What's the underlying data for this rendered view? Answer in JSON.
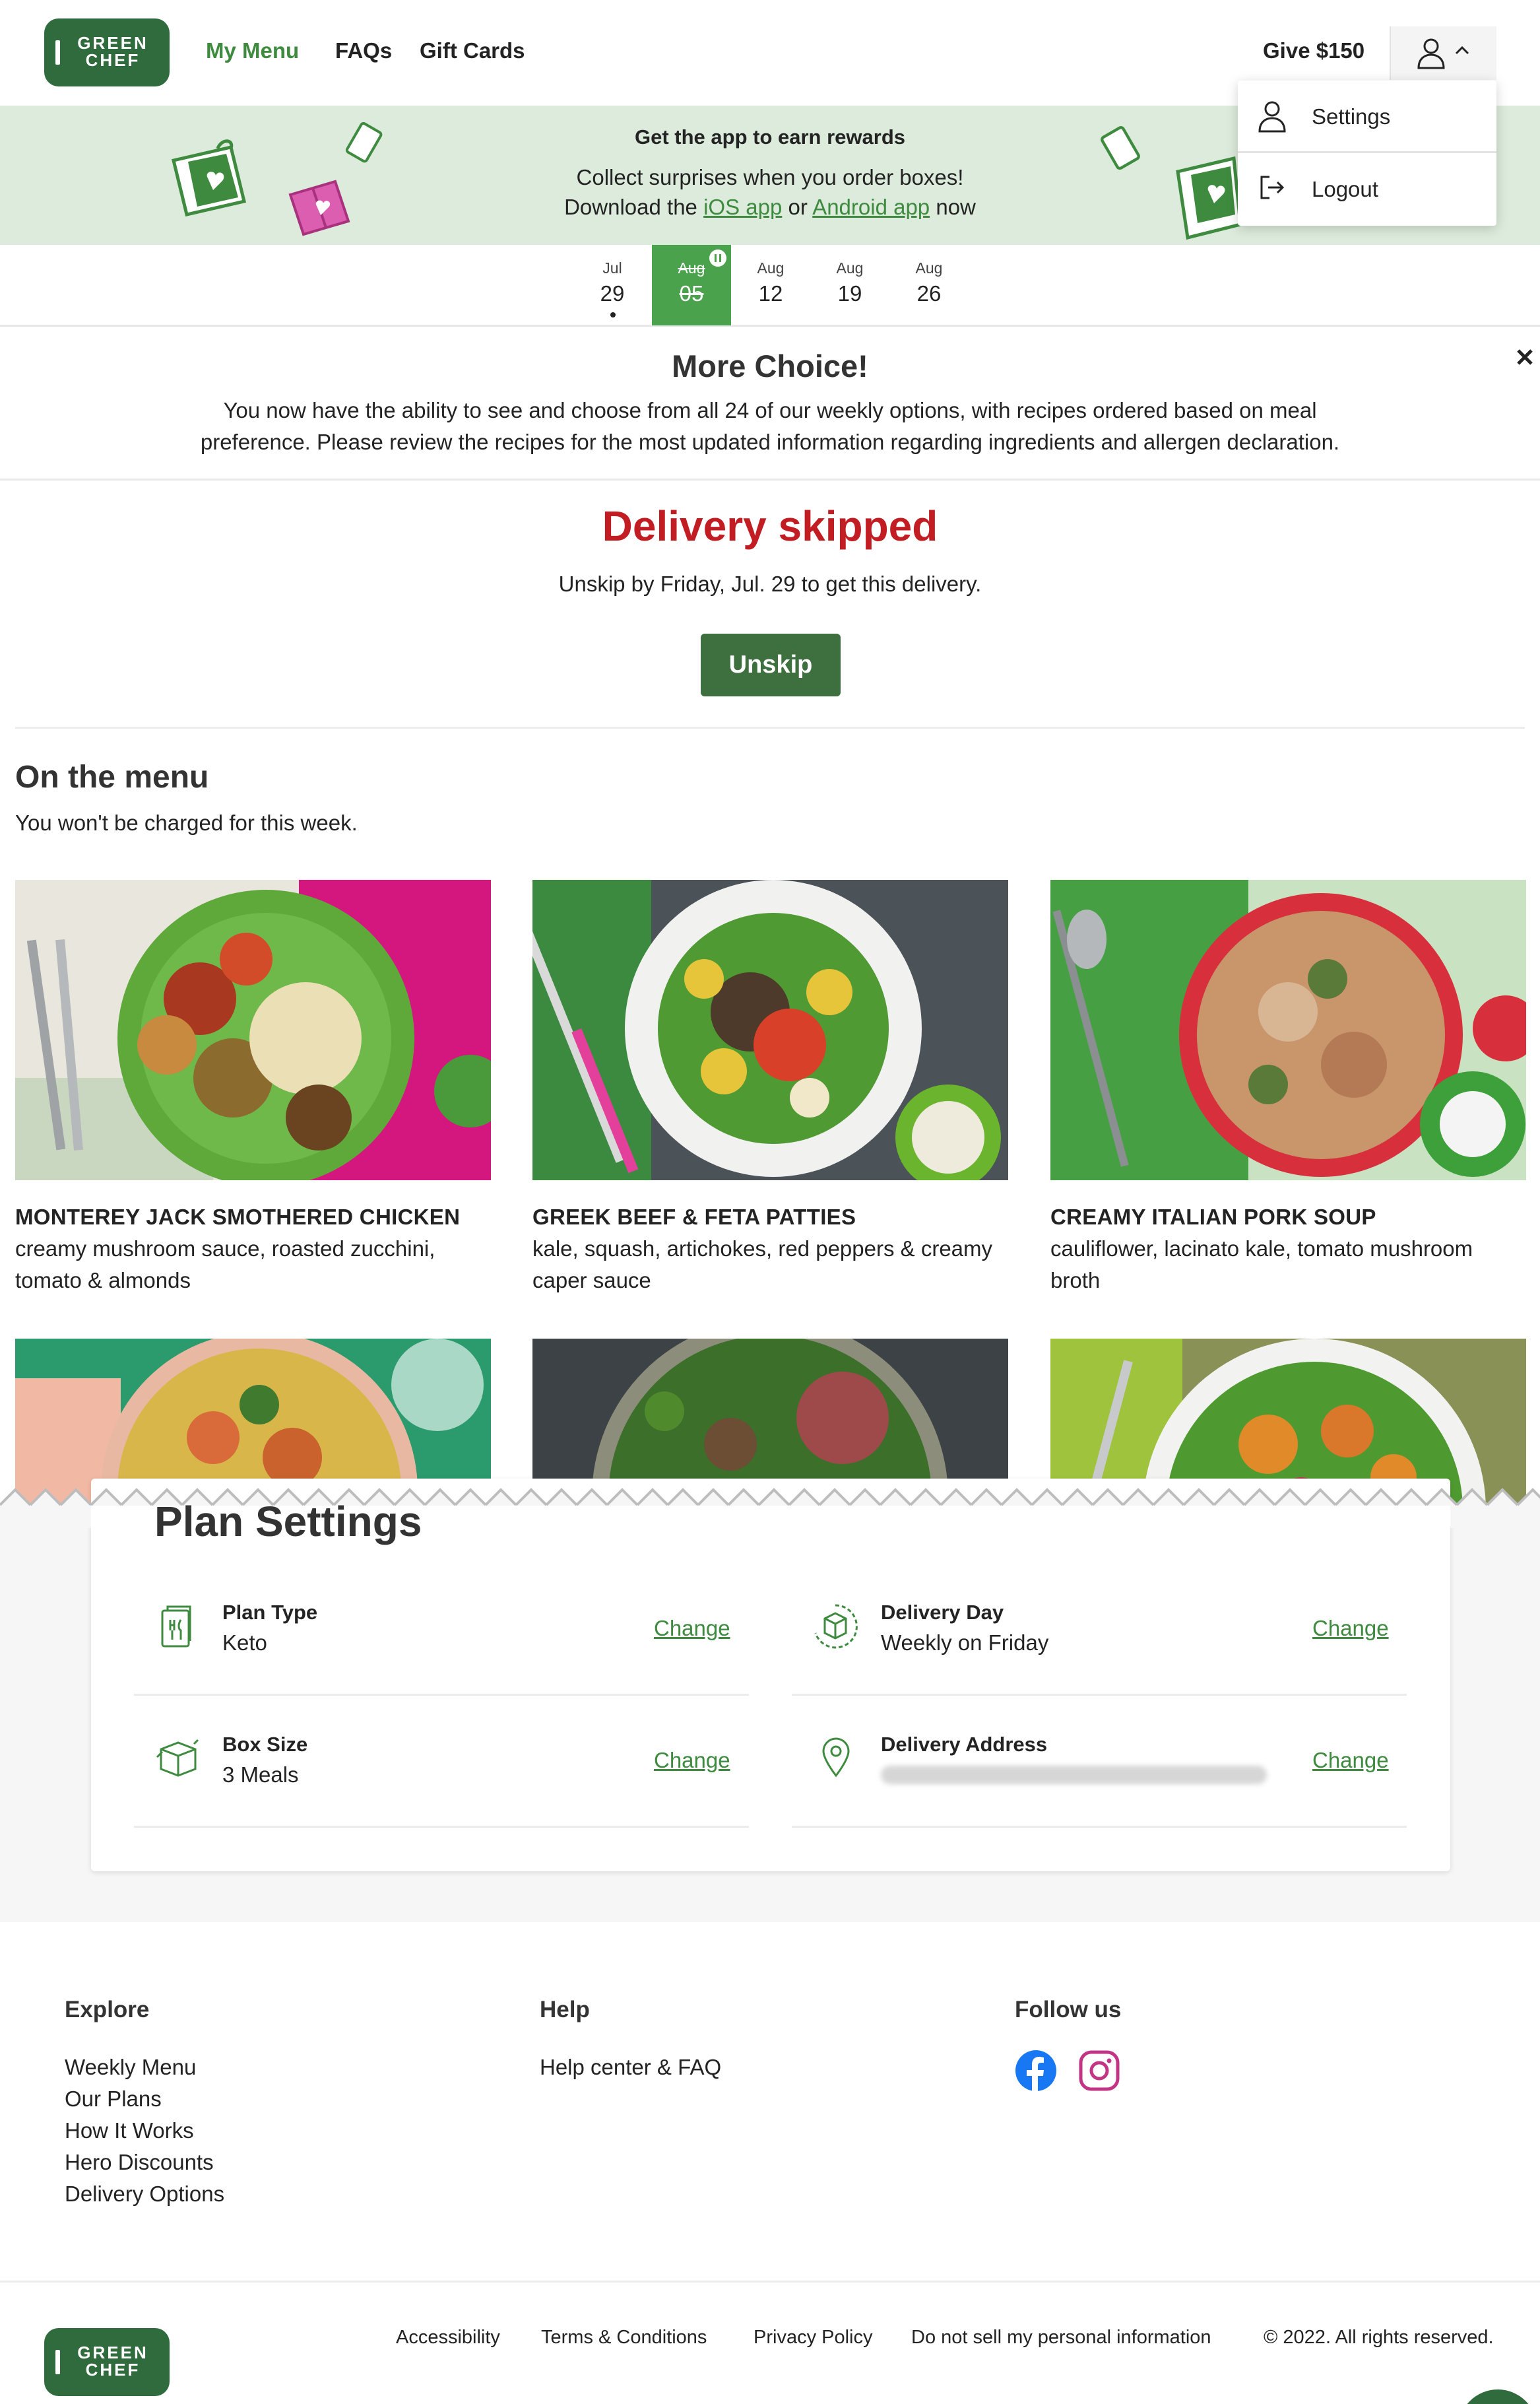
{
  "header": {
    "logo_line1": "GREEN",
    "logo_line2": "CHEF",
    "nav": [
      "My Menu",
      "FAQs",
      "Gift Cards"
    ],
    "give_label": "Give $150"
  },
  "account_menu": {
    "items": [
      "Settings",
      "Logout"
    ]
  },
  "promo": {
    "title": "Get the app to earn rewards",
    "line1": "Collect surprises when you order boxes!",
    "line2_pre": "Download the ",
    "ios_link": "iOS app",
    "line2_mid": " or ",
    "android_link": "Android app",
    "line2_post": " now"
  },
  "weeks": [
    {
      "month": "Jul",
      "day": "29",
      "selected": false
    },
    {
      "month": "Aug",
      "day": "05",
      "selected": true
    },
    {
      "month": "Aug",
      "day": "12",
      "selected": false
    },
    {
      "month": "Aug",
      "day": "19",
      "selected": false
    },
    {
      "month": "Aug",
      "day": "26",
      "selected": false
    }
  ],
  "notice": {
    "title": "More Choice!",
    "body": "You now have the ability to see and choose from all 24 of our weekly options, with recipes ordered based on meal preference. Please review the recipes for the most updated information regarding ingredients and allergen declaration."
  },
  "delivery": {
    "status": "Delivery skipped",
    "message": "Unskip by Friday, Jul. 29 to get this delivery.",
    "button": "Unskip"
  },
  "menu": {
    "title": "On the menu",
    "subtitle": "You won't be charged for this week.",
    "recipes": [
      {
        "name": "MONTEREY JACK SMOTHERED CHICKEN",
        "desc": "creamy mushroom sauce, roasted zucchini, tomato & almonds"
      },
      {
        "name": "GREEK BEEF & FETA PATTIES",
        "desc": "kale, squash, artichokes, red peppers & creamy caper sauce"
      },
      {
        "name": "CREAMY ITALIAN PORK SOUP",
        "desc": "cauliflower, lacinato kale, tomato mushroom broth"
      }
    ]
  },
  "plan_settings": {
    "title": "Plan Settings",
    "change_label": "Change",
    "items": [
      {
        "label": "Plan Type",
        "value": "Keto"
      },
      {
        "label": "Delivery Day",
        "value": "Weekly on Friday"
      },
      {
        "label": "Box Size",
        "value": "3 Meals"
      },
      {
        "label": "Delivery Address",
        "value": ""
      }
    ]
  },
  "footer": {
    "explore_title": "Explore",
    "explore_links": [
      "Weekly Menu",
      "Our Plans",
      "How It Works",
      "Hero Discounts",
      "Delivery Options"
    ],
    "help_title": "Help",
    "help_links": [
      "Help center & FAQ"
    ],
    "follow_title": "Follow us",
    "legal_links": [
      "Accessibility",
      "Terms & Conditions",
      "Privacy Policy",
      "Do not sell my personal information"
    ],
    "copyright": "© 2022. All rights reserved."
  },
  "colors": {
    "brand_green": "#2f6b3c",
    "accent_green": "#3e8b3f",
    "selected_week": "#4aa34c",
    "promo_bg": "#dcebdc",
    "skipped_red": "#c21d23",
    "facebook_blue": "#1877f2",
    "instagram_magenta": "#c13584"
  }
}
